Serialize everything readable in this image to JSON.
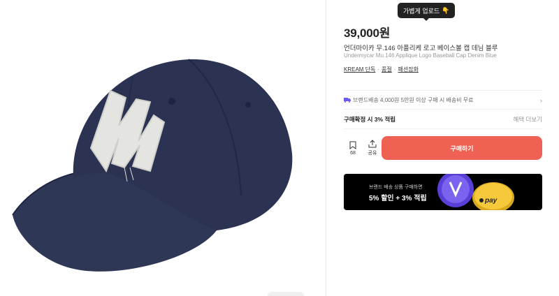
{
  "tooltip": {
    "text": "가볍게 업로드",
    "emoji": "👇"
  },
  "product": {
    "price": "39,000원",
    "name_ko": "언더마이카 무.146 아플리케 로고 베이스볼 캡 데님 블루",
    "name_en": "Undermycar Mu.146 Applique Logo Baseball Cap Denim Blue",
    "tags": [
      "KREAM 단독",
      "품절",
      "패션잡화"
    ]
  },
  "shipping": {
    "text": "브랜드배송 4,000원 5만원 이상 구매 시 배송비 무료"
  },
  "points": {
    "label": "구매확정 시 3% 적립",
    "more": "혜택 더보기"
  },
  "actions": {
    "bookmark_count": "68",
    "share_label": "공유",
    "buy_label": "구매하기"
  },
  "banner": {
    "subtitle": "브랜드 배송 상품 구매하면",
    "title": "5% 할인 + 3% 적립",
    "pay_label": "pay"
  },
  "colors": {
    "buy": "#ef6253",
    "banner_bg": "#000000",
    "coin_gold": "#f5c93a",
    "coin_purple": "#5a3fd6"
  }
}
